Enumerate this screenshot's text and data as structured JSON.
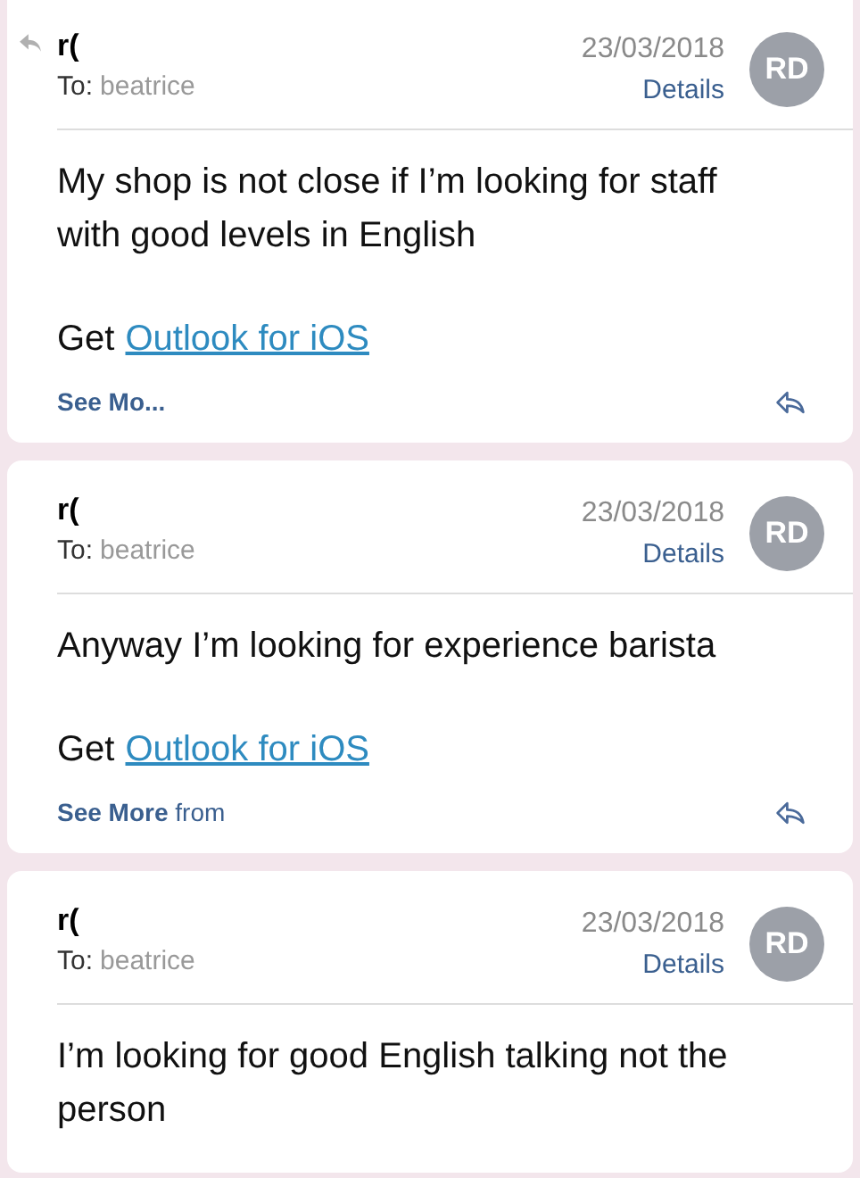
{
  "emails": [
    {
      "replied": true,
      "sender": "r(",
      "to_label": "To:",
      "to": "beatrice",
      "date": "23/03/2018",
      "details": "Details",
      "initials": "RD",
      "body": [
        "My shop is not close if I’m looking for staff with good levels in English"
      ],
      "signature": {
        "prefix": "Get",
        "link": "Outlook for iOS"
      },
      "see_more": {
        "label": "See Mo..."
      }
    },
    {
      "replied": false,
      "sender": "r(",
      "to_label": "To:",
      "to": "beatrice",
      "date": "23/03/2018",
      "details": "Details",
      "initials": "RD",
      "body": [
        "Anyway I’m looking for experience barista"
      ],
      "signature": {
        "prefix": "Get",
        "link": "Outlook for iOS"
      },
      "see_more": {
        "label": "See More",
        "suffix": "from"
      }
    },
    {
      "replied": false,
      "sender": "r(",
      "to_label": "To:",
      "to": "beatrice",
      "date": "23/03/2018",
      "details": "Details",
      "initials": "RD",
      "body": [
        "I’m looking for good English talking not the person"
      ]
    }
  ]
}
